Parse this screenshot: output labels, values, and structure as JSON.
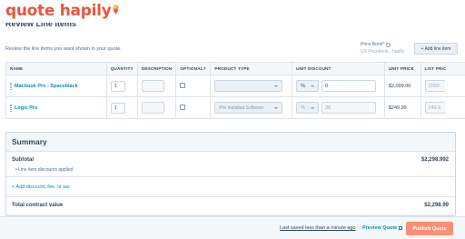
{
  "brand": {
    "name": "quote hapily",
    "color": "#e8553e",
    "icon": "ice-cream-pin-icon"
  },
  "section": {
    "heading": "Review Line Items",
    "intro": "Review the line items you want shown in your quote."
  },
  "price_book": {
    "label": "Price Book*",
    "value": "US Pricebook - hapily"
  },
  "add_line_item": "+ Add line item",
  "table": {
    "columns": [
      "NAME",
      "QUANTITY",
      "DESCRIPTION",
      "OPTIONAL?",
      "PRODUCT TYPE",
      "UNIT DISCOUNT",
      "UNIT PRICE",
      "LIST PRIC"
    ],
    "rows": [
      {
        "name": "Macbook Pro - Spaceblack",
        "quantity": "1",
        "product_type": "",
        "discount_type": "%",
        "discount_value": "0",
        "unit_price": "$2,099.00",
        "list_price": "2099"
      },
      {
        "name": "Logic Pro",
        "quantity": "1",
        "product_type": "Pre Installed Software",
        "discount_type": "%",
        "discount_value": "20",
        "unit_price": "$249.99",
        "list_price": "249.9"
      }
    ]
  },
  "summary": {
    "heading": "Summary",
    "subtotal_label": "Subtotal",
    "subtotal_value": "$2,298.992",
    "discount_note": "Line item discounts applied",
    "add_link": "+ Add discount, fee, or tax",
    "total_label": "Total contract value",
    "total_value": "$2,298.99"
  },
  "footer": {
    "last_saved": "Last saved less than a minute ago",
    "preview": "Preview Quote",
    "publish": "Publish Quote"
  }
}
